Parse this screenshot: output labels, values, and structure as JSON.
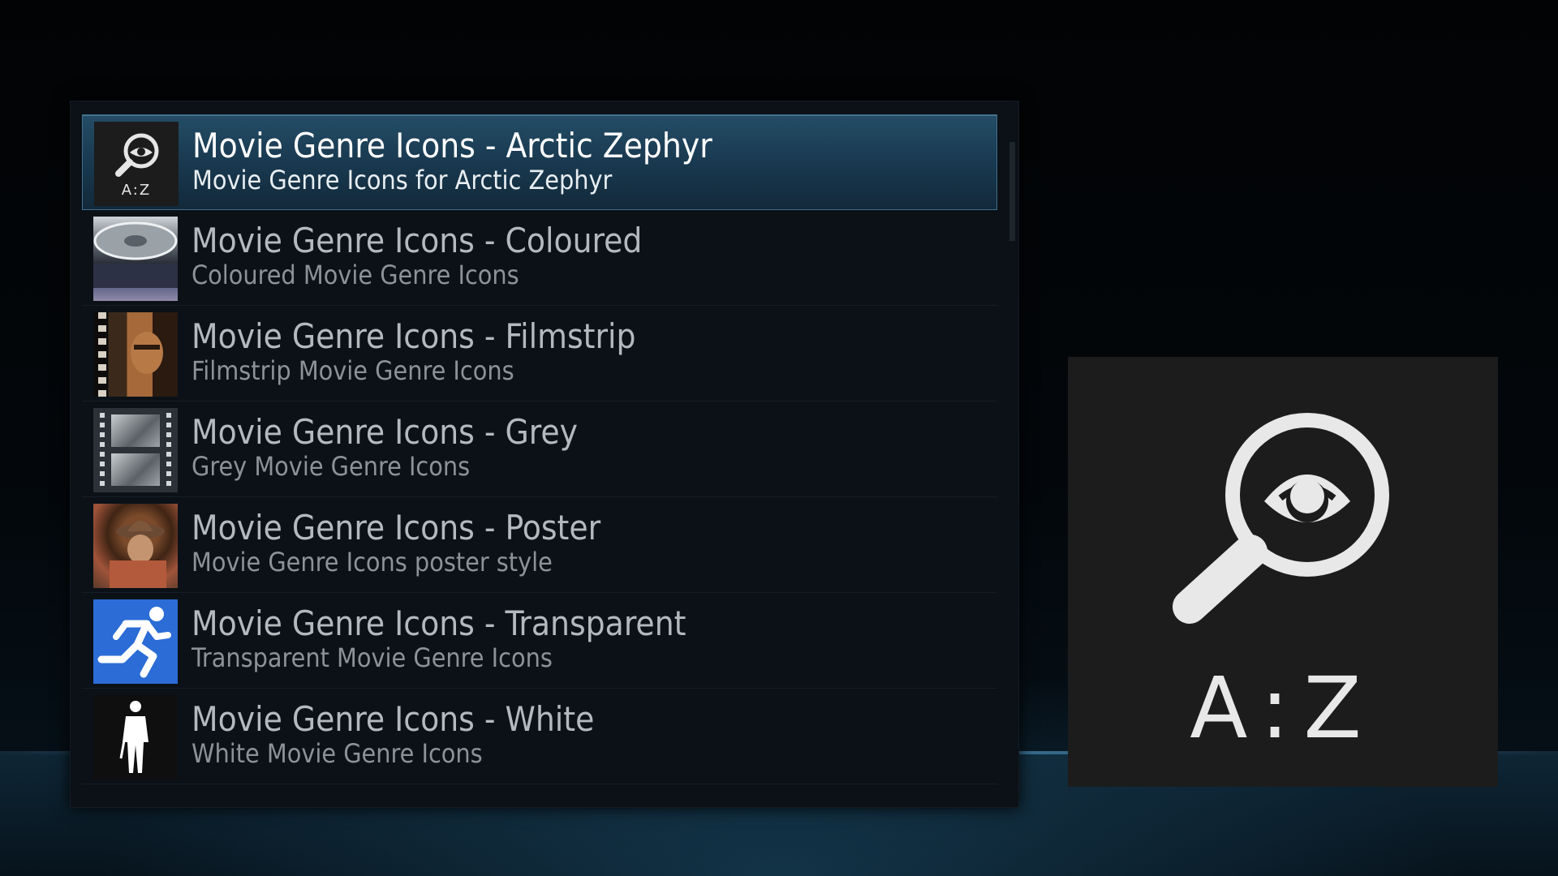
{
  "list": {
    "items": [
      {
        "title": "Movie Genre Icons - Arctic Zephyr",
        "subtitle": "Movie Genre Icons for Arctic Zephyr",
        "icon": "az-magnifier-eye-icon",
        "thumb_text": "A:Z",
        "focused": true
      },
      {
        "title": "Movie Genre Icons - Coloured",
        "subtitle": "Coloured Movie Genre Icons",
        "icon": "film-reel-thumbnail",
        "focused": false
      },
      {
        "title": "Movie Genre Icons - Filmstrip",
        "subtitle": "Filmstrip Movie Genre Icons",
        "icon": "filmstrip-thumbnail",
        "focused": false
      },
      {
        "title": "Movie Genre Icons - Grey",
        "subtitle": "Grey Movie Genre Icons",
        "icon": "grey-filmstrip-thumbnail",
        "focused": false
      },
      {
        "title": "Movie Genre Icons - Poster",
        "subtitle": "Movie Genre Icons poster style",
        "icon": "poster-thumbnail",
        "focused": false
      },
      {
        "title": "Movie Genre Icons - Transparent",
        "subtitle": "Transparent Movie Genre Icons",
        "icon": "running-man-icon",
        "focused": false
      },
      {
        "title": "Movie Genre Icons - White",
        "subtitle": "White Movie Genre Icons",
        "icon": "man-silhouette-icon",
        "focused": false
      }
    ]
  },
  "preview": {
    "icon": "az-magnifier-eye-icon",
    "text": "A:Z"
  },
  "colors": {
    "focus_highlight": "#244d66",
    "transparent_icon_bg": "#2b6cd6",
    "preview_bg": "#1c1c1c"
  }
}
